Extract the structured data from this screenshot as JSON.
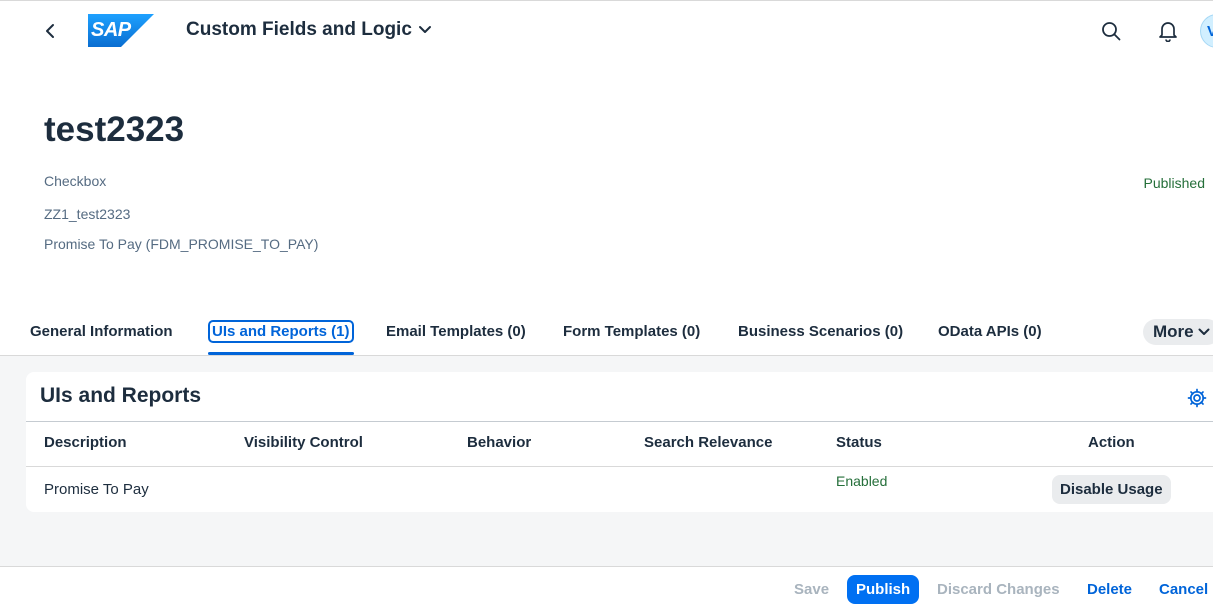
{
  "shell": {
    "app_title": "Custom Fields and Logic",
    "logo_text": "SAP",
    "avatar_initial": "V",
    "brand_color": "#0a6ed1"
  },
  "header": {
    "title": "test2323",
    "type": "Checkbox",
    "identifier": "ZZ1_test2323",
    "business_context": "Promise To Pay (FDM_PROMISE_TO_PAY)",
    "status": "Published"
  },
  "tabs": [
    {
      "label": "General Information"
    },
    {
      "label": "UIs and Reports (1)"
    },
    {
      "label": "Email Templates (0)"
    },
    {
      "label": "Form Templates (0)"
    },
    {
      "label": "Business Scenarios (0)"
    },
    {
      "label": "OData APIs (0)"
    }
  ],
  "more_label": "More",
  "section": {
    "title": "UIs and Reports",
    "columns": [
      "Description",
      "Visibility Control",
      "Behavior",
      "Search Relevance",
      "Status",
      "Action"
    ],
    "rows": [
      {
        "description": "Promise To Pay",
        "visibility": "",
        "behavior": "",
        "search_relevance": "",
        "status": "Enabled",
        "action": "Disable Usage"
      }
    ]
  },
  "footer": {
    "save": "Save",
    "publish": "Publish",
    "discard": "Discard Changes",
    "delete": "Delete",
    "cancel": "Cancel"
  }
}
